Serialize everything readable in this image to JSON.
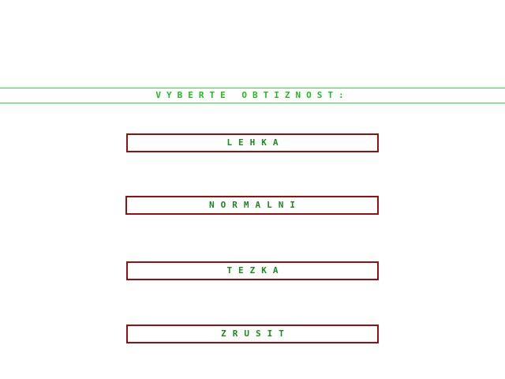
{
  "header": {
    "title": "Vyberte obtiznost:"
  },
  "menu": {
    "items": [
      {
        "label": "Lehka"
      },
      {
        "label": "Normalni"
      },
      {
        "label": "Tezka"
      },
      {
        "label": "Zrusit"
      }
    ]
  },
  "colors": {
    "line": "#33dd33",
    "text": "#1a8a1a",
    "border": "#990f0f",
    "background": "#ffffff"
  }
}
